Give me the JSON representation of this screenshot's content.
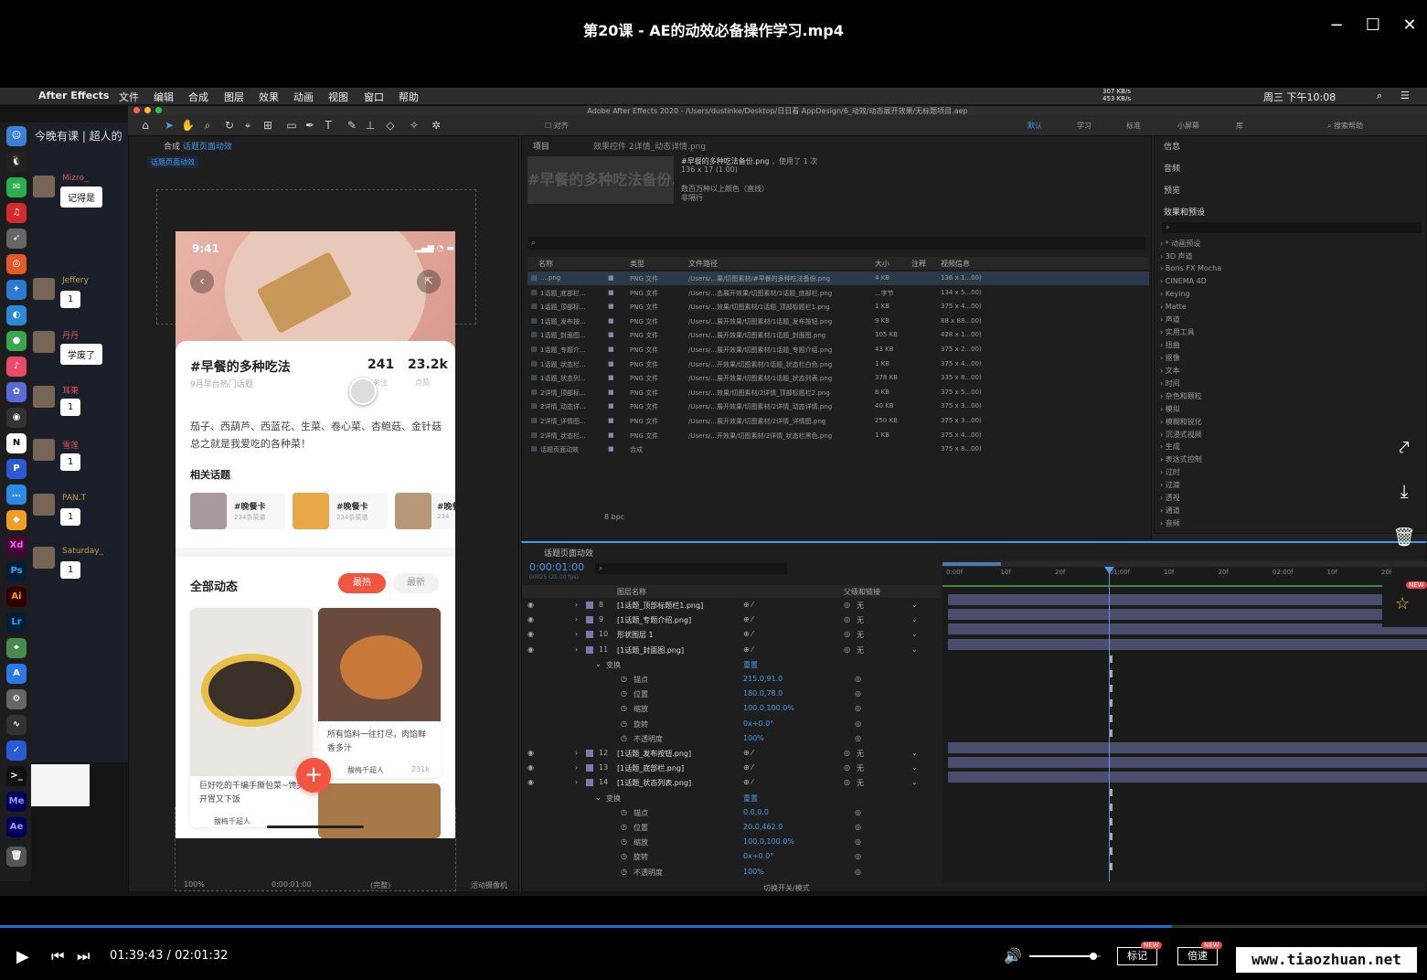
{
  "player": {
    "title": "第20课 - AE的动效必备操作学习.mp4",
    "time_current": "01:39:43",
    "time_separator": "/",
    "time_total": "02:01:32",
    "progress": 0.821,
    "volume": 0.9,
    "mark_label": "标记",
    "speed_label": "倍速",
    "new_badge": "NEW",
    "watermark": "www.tiaozhuan.net"
  },
  "macbar": {
    "app": "After Effects",
    "menus": [
      "文件",
      "编辑",
      "合成",
      "图层",
      "效果",
      "动画",
      "视图",
      "窗口",
      "帮助"
    ],
    "net_up": "307 KB/s",
    "net_down": "453 KB/s",
    "clock": "周三 下午10:08"
  },
  "chat": {
    "header": "今晚有课 | 超人的",
    "messages": [
      {
        "name": "Mizro_",
        "text": "记得是"
      },
      {
        "name": "Jeffery",
        "text": "1"
      },
      {
        "name": "丹丹",
        "text": "学废了"
      },
      {
        "name": "耳東",
        "text": "1"
      },
      {
        "name": "雪莲",
        "text": "1"
      },
      {
        "name": "PAN.T",
        "text": "1"
      },
      {
        "name": "Saturday_",
        "text": "1"
      }
    ]
  },
  "ae": {
    "window_title": "Adobe After Effects 2020 - /Users/dustinke/Desktop/日日看 AppDesign/6_动效/动态展开效果/无标题项目.aep",
    "align_label": "对齐",
    "workspaces": [
      "默认",
      "学习",
      "标准",
      "小屏幕",
      "库"
    ],
    "search_help": "搜索帮助",
    "comp_tab": "合成",
    "comp_name": "话题页面动效",
    "comp_subtab": "话题页面动效",
    "zoom": "100%",
    "comp_time": "0:00:01:00",
    "quality": "(完整)",
    "camera": "活动摄像机",
    "project_tab": "项目",
    "effects_controls_tab": "效果控件 2详情_动态详情.png",
    "preview_name": "#早餐的多种吃法备份.png",
    "preview_used": "，使用了 1 次",
    "preview_size": "136 x 17 (1.00)",
    "preview_colors": "数百万种以上颜色（直线）",
    "preview_interlace": "非隔行",
    "project_columns": [
      "名称",
      "类型",
      "文件路径",
      "大小",
      "注释",
      "视频信息"
    ],
    "project_rows": [
      {
        "name": "....png",
        "type": "PNG 文件",
        "path": "/Users/...果/切图素材/#早餐的多种吃法备份.png",
        "size": "4 KB",
        "info": "136 x 1...00)"
      },
      {
        "name": "1话题_底部栏...",
        "type": "PNG 文件",
        "path": "/Users/...态展开效果/切图素材/1话题_底部栏.png",
        "size": "...字节",
        "info": "134 x 5...00)"
      },
      {
        "name": "1话题_顶部标...",
        "type": "PNG 文件",
        "path": "/Users/...效果/切图素材/1话题_顶部标题栏1.png",
        "size": "1 KB",
        "info": "375 x 4...00)"
      },
      {
        "name": "1话题_发布按...",
        "type": "PNG 文件",
        "path": "/Users/...展开效果/切图素材/1话题_发布按钮.png",
        "size": "9 KB",
        "info": "88 x 88...00)"
      },
      {
        "name": "1话题_封面图...",
        "type": "PNG 文件",
        "path": "/Users/...展开效果/切图素材/1话题_封面图.png",
        "size": "105 KB",
        "info": "428 x 1...00)"
      },
      {
        "name": "1话题_专题介...",
        "type": "PNG 文件",
        "path": "/Users/...展开效果/切图素材/1话题_专题介绍.png",
        "size": "43 KB",
        "info": "375 x 2...00)"
      },
      {
        "name": "1话题_状态栏...",
        "type": "PNG 文件",
        "path": "/Users/...开效果/切图素材/1话题_状态栏白色.png",
        "size": "1 KB",
        "info": "375 x 4...00)"
      },
      {
        "name": "1话题_状态列...",
        "type": "PNG 文件",
        "path": "/Users/...展开效果/切图素材/1话题_状态列表.png",
        "size": "378 KB",
        "info": "335 x 8...00)"
      },
      {
        "name": "2详情_顶部标...",
        "type": "PNG 文件",
        "path": "/Users/...效果/切图素材/2详情_顶部标题栏2.png",
        "size": "8 KB",
        "info": "375 x 5...00)"
      },
      {
        "name": "2详情_动态详...",
        "type": "PNG 文件",
        "path": "/Users/...展开效果/切图素材/2详情_动态详情.png",
        "size": "40 KB",
        "info": "375 x 3...00)"
      },
      {
        "name": "2详情_详情图...",
        "type": "PNG 文件",
        "path": "/Users/...展开效果/切图素材/2详情_详情图.png",
        "size": "250 KB",
        "info": "375 x 3...00)"
      },
      {
        "name": "2详情_状态栏...",
        "type": "PNG 文件",
        "path": "/Users/...开效果/切图素材/2详情_状态栏黑色.png",
        "size": "1 KB",
        "info": "375 x 4...00)"
      },
      {
        "name": "话题页面动效",
        "type": "合成",
        "path": "",
        "size": "",
        "info": "375 x 8...00)"
      }
    ],
    "bpc": "8 bpc",
    "right_panels": [
      "信息",
      "音频",
      "预览",
      "效果和预设"
    ],
    "effects": [
      "* 动画预设",
      "3D 声道",
      "Boris FX Mocha",
      "CINEMA 4D",
      "Keying",
      "Matte",
      "声道",
      "实用工具",
      "扭曲",
      "抠像",
      "文本",
      "时间",
      "杂色和颗粒",
      "模拟",
      "模糊和锐化",
      "沉浸式视频",
      "生成",
      "表达式控制",
      "过时",
      "过渡",
      "透视",
      "通道",
      "音频"
    ],
    "timeline_tab": "话题页面动效",
    "timecode": "0:00:01:00",
    "timecode_sub": "00025 (25.00 fps)",
    "layer_col_name": "图层名称",
    "layer_col_parent": "父级和链接",
    "ruler": [
      "0:00f",
      "10f",
      "20f",
      "01:00f",
      "10f",
      "20f",
      "02:00f",
      "10f",
      "20f"
    ],
    "layers": [
      {
        "num": "8",
        "name": "[1话题_顶部标题栏1.png]",
        "parent": "无",
        "kind": "layer"
      },
      {
        "num": "9",
        "name": "[1话题_专题介绍.png]",
        "parent": "无",
        "kind": "layer"
      },
      {
        "num": "10",
        "name": "形状图层 1",
        "parent": "无",
        "kind": "layer"
      },
      {
        "num": "11",
        "name": "[1话题_封面图.png]",
        "parent": "无",
        "kind": "layer"
      },
      {
        "num": "",
        "name": "变换",
        "parent": "重置",
        "kind": "group"
      },
      {
        "num": "",
        "name": "锚点",
        "parent": "215.0,91.0",
        "kind": "prop"
      },
      {
        "num": "",
        "name": "位置",
        "parent": "180.0,78.0",
        "kind": "prop"
      },
      {
        "num": "",
        "name": "缩放",
        "parent": "100.0,100.0%",
        "kind": "prop"
      },
      {
        "num": "",
        "name": "旋转",
        "parent": "0x+0.0°",
        "kind": "prop"
      },
      {
        "num": "",
        "name": "不透明度",
        "parent": "100%",
        "kind": "prop"
      },
      {
        "num": "12",
        "name": "[1话题_发布按钮.png]",
        "parent": "无",
        "kind": "layer"
      },
      {
        "num": "13",
        "name": "[1话题_底部栏.png]",
        "parent": "无",
        "kind": "layer"
      },
      {
        "num": "14",
        "name": "[1话题_状态列表.png]",
        "parent": "无",
        "kind": "layer"
      },
      {
        "num": "",
        "name": "变换",
        "parent": "重置",
        "kind": "group"
      },
      {
        "num": "",
        "name": "锚点",
        "parent": "0.0,0.0",
        "kind": "prop"
      },
      {
        "num": "",
        "name": "位置",
        "parent": "20.0,462.0",
        "kind": "prop"
      },
      {
        "num": "",
        "name": "缩放",
        "parent": "100.0,100.0%",
        "kind": "prop"
      },
      {
        "num": "",
        "name": "旋转",
        "parent": "0x+0.0°",
        "kind": "prop"
      },
      {
        "num": "",
        "name": "不透明度",
        "parent": "100%",
        "kind": "prop"
      }
    ],
    "switch_mode": "切换开关/模式"
  },
  "phone": {
    "status_time": "9:41",
    "topic_title": "#早餐的多种吃法",
    "topic_sub": "9月早台热门话题",
    "stat1_value": "241",
    "stat1_label": "关注",
    "stat2_value": "23.2k",
    "stat2_label": "点赞",
    "desc": "茄子、西葫芦、西蓝花、生菜、卷心菜、杏鲍菇、金针菇总之就是我爱吃的各种菜！",
    "related_title": "相关话题",
    "related": [
      {
        "name": "#晚餐卡",
        "count": "234条菜谱"
      },
      {
        "name": "#晚餐卡",
        "count": "234条菜谱"
      },
      {
        "name": "#晚餐",
        "count": "234"
      }
    ],
    "all_title": "全部动态",
    "tab_hot": "最热",
    "tab_new": "最新",
    "card1_text": "巨好吃的千编手撕包菜~馋哭开胃又下饭",
    "card1_author": "馥梅千超人",
    "card2_text": "所有馅料一往打尽，肉馅鲜香多汁",
    "card2_author": "馥梅千超人",
    "card2_likes": "231k",
    "colors": {
      "accent": "#f2553f",
      "hot_tab": "#f2553f"
    }
  }
}
